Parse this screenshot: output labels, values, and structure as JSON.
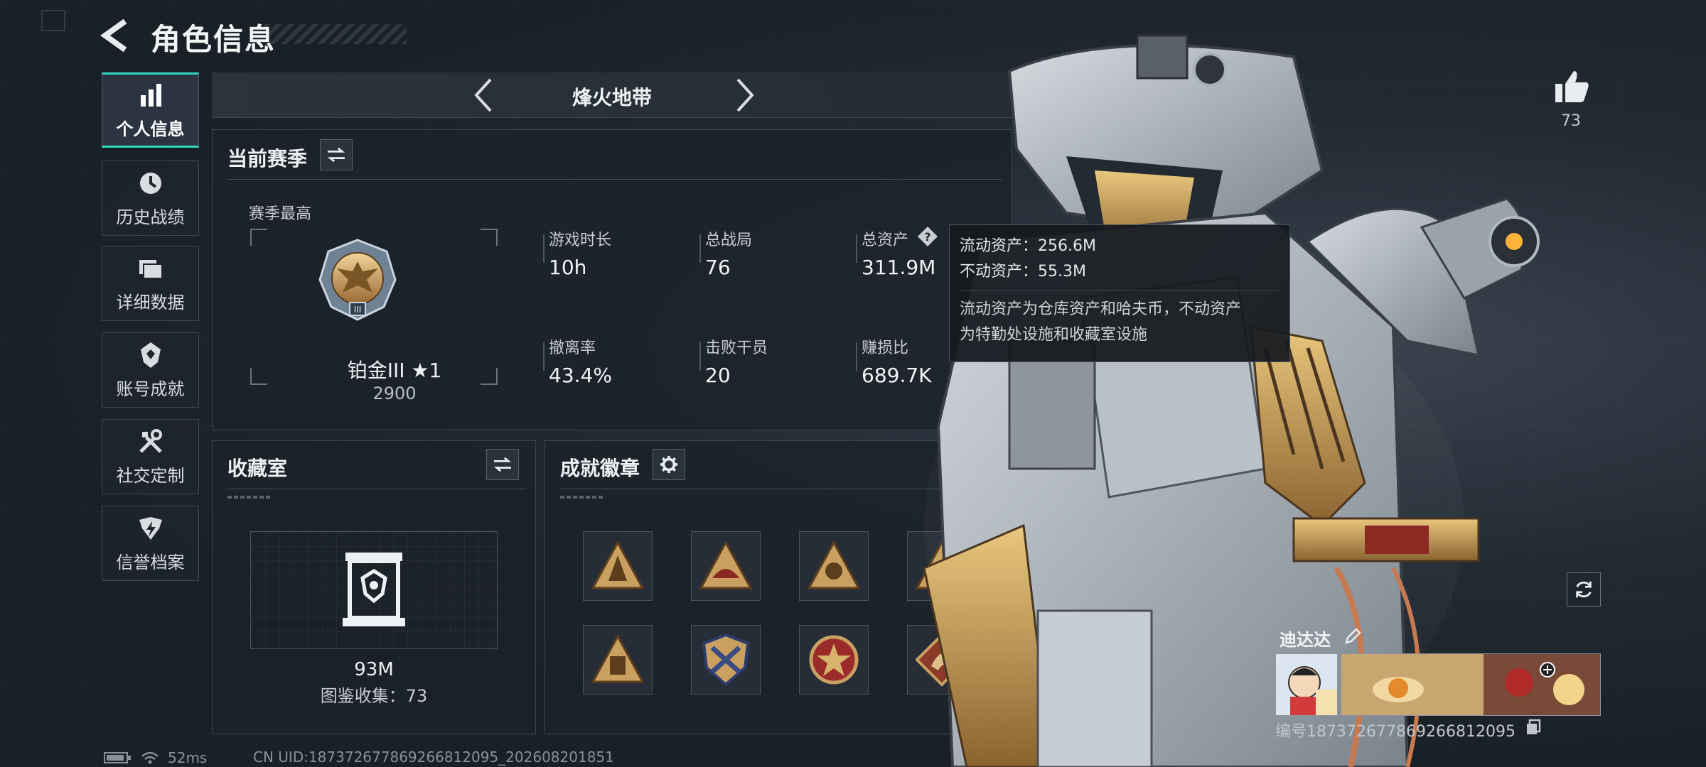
{
  "header": {
    "title": "角色信息"
  },
  "nav": {
    "items": [
      {
        "label": "个人信息",
        "icon": "bar-chart-icon",
        "active": true
      },
      {
        "label": "历史战绩",
        "icon": "clock-icon",
        "active": false
      },
      {
        "label": "详细数据",
        "icon": "folders-icon",
        "active": false
      },
      {
        "label": "账号成就",
        "icon": "achievement-icon",
        "active": false
      },
      {
        "label": "社交定制",
        "icon": "tools-icon",
        "active": false
      },
      {
        "label": "信誉档案",
        "icon": "credit-icon",
        "active": false
      }
    ]
  },
  "mode": {
    "name": "烽火地带"
  },
  "season": {
    "title": "当前赛季",
    "best_label": "赛季最高",
    "rank_name": "铂金III ★1",
    "rank_score": "2900",
    "stats": [
      {
        "label": "游戏时长",
        "value": "10h"
      },
      {
        "label": "总战局",
        "value": "76"
      },
      {
        "label": "总资产",
        "value": "311.9M"
      },
      {
        "label": "撤离率",
        "value": "43.4%"
      },
      {
        "label": "击败干员",
        "value": "20"
      },
      {
        "label": "赚损比",
        "value": "689.7K"
      }
    ]
  },
  "tooltip": {
    "liquid": "流动资产：256.6M",
    "fixed": "不动资产：55.3M",
    "desc_line1": "流动资产为仓库资产和哈夫币，不动资产",
    "desc_line2": "为特勤处设施和收藏室设施"
  },
  "collection": {
    "title": "收藏室",
    "value": "93M",
    "count": "图鉴收集：73"
  },
  "badges": {
    "title": "成就徽章",
    "icons": [
      "badge-triangle-1",
      "badge-triangle-2",
      "badge-triangle-3",
      "badge-triangle-4",
      "badge-triangle-5",
      "badge-shield",
      "badge-star-emblem",
      "badge-dragon"
    ]
  },
  "profile": {
    "likes": "73",
    "name": "迪达达",
    "id_text": "编号187372677869266812095"
  },
  "status": {
    "ping": "52ms",
    "uid": "CN UID:187372677869266812095_202608201851"
  },
  "colors": {
    "accent": "#31d7c2",
    "badge_gold": "#c9a060",
    "tooltip_bg": "#16191f"
  }
}
